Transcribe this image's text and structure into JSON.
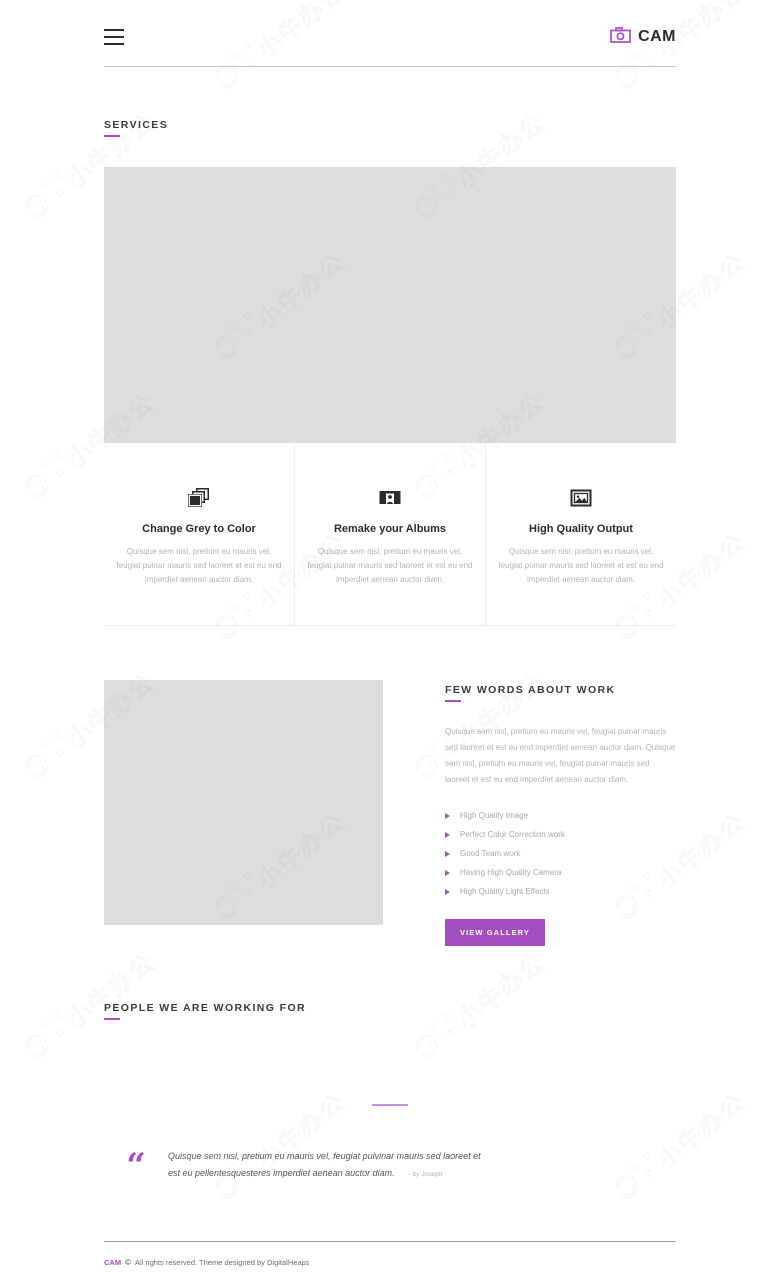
{
  "header": {
    "menu_label": "menu-toggle",
    "brand_icon": "camera-icon",
    "brand_text": "CAM"
  },
  "services": {
    "title": "SERVICES",
    "hero_placeholder": "image-placeholder",
    "items": [
      {
        "icon": "photo-stack-icon",
        "name": "Change Grey to Color",
        "desc": "Quisque sem nisl, pretium eu mauris vel, feugiat puinar mauris sed laoreet et est eu end imperdiet aenean auctor diam."
      },
      {
        "icon": "album-portrait-icon",
        "name": "Remake your Albums",
        "desc": "Quisque sem nisl, pretium eu mauris vel, feugiat puinar mauris sed laoreet et est eu end imperdiet aenean auctor diam."
      },
      {
        "icon": "picture-frame-icon",
        "name": "High Quality Output",
        "desc": "Quisque sem nisl, pretium eu mauris vel, feugiat puinar mauris sed laoreet et est eu end imperdiet aenean auctor diam."
      }
    ]
  },
  "about": {
    "title": "FEW WORDS ABOUT WORK",
    "image_placeholder": "image-placeholder",
    "paragraph": "Quisque sem nisl, pretium eu mauris vel, feugiat puinar mauris sed laoreet et est eu end imperdiet aenean auctor diam. Quisque sem nisl, pretium eu mauris vel, feugiat puinar mauris sed laoreet et est eu end imperdiet aenean auctor diam.",
    "features": [
      "High Quality Image",
      "Perfect Color Correction work",
      "Good Team work",
      "Having High Quality Camera",
      "High Quality Light Effects"
    ],
    "button_label": "VIEW GALLERY"
  },
  "clients": {
    "title": "PEOPLE WE ARE WORKING FOR"
  },
  "testimonial": {
    "quote_glyph": "“",
    "text": "Quisque sem nisl, pretium eu mauris vel, feugiat pulvinar mauris sed laoreet et est eu pellentesquesteres imperdiet aenean auctor diam.",
    "author": "- by Joseph"
  },
  "footer": {
    "brand": "CAM",
    "copy_symbol": "©",
    "text": "All rights reserved. Theme designed by DigitalHeaps"
  },
  "colors": {
    "accent": "#a94fc4",
    "button": "#a04ec0",
    "placeholder": "#dedede",
    "text_muted": "#b4b4b4"
  },
  "watermark": {
    "mark": "ɔ∵",
    "text": "小牛办公"
  }
}
